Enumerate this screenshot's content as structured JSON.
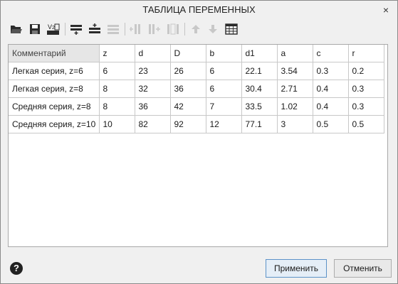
{
  "window": {
    "title": "ТАБЛИЦА ПЕРЕМЕННЫХ",
    "close_glyph": "×"
  },
  "toolbar": {
    "buttons": [
      {
        "name": "open-icon",
        "enabled": true
      },
      {
        "name": "save-icon",
        "enabled": true
      },
      {
        "name": "variables-v2-icon",
        "enabled": true
      },
      {
        "name": "insert-row-above-icon",
        "enabled": true
      },
      {
        "name": "insert-row-below-icon",
        "enabled": true
      },
      {
        "name": "delete-row-icon",
        "enabled": false
      },
      {
        "name": "insert-column-left-icon",
        "enabled": false
      },
      {
        "name": "insert-column-right-icon",
        "enabled": false
      },
      {
        "name": "delete-column-icon",
        "enabled": false
      },
      {
        "name": "move-up-icon",
        "enabled": false
      },
      {
        "name": "move-down-icon",
        "enabled": false
      },
      {
        "name": "table-settings-icon",
        "enabled": true
      }
    ]
  },
  "table": {
    "headers": [
      "Комментарий",
      "z",
      "d",
      "D",
      "b",
      "d1",
      "a",
      "c",
      "r"
    ],
    "rows": [
      [
        "Легкая серия, z=6",
        "6",
        "23",
        "26",
        "6",
        "22.1",
        "3.54",
        "0.3",
        "0.2"
      ],
      [
        "Легкая серия, z=8",
        "8",
        "32",
        "36",
        "6",
        "30.4",
        "2.71",
        "0.4",
        "0.3"
      ],
      [
        "Средняя серия, z=8",
        "8",
        "36",
        "42",
        "7",
        "33.5",
        "1.02",
        "0.4",
        "0.3"
      ],
      [
        "Средняя серия, z=10",
        "10",
        "82",
        "92",
        "12",
        "77.1",
        "3",
        "0.5",
        "0.5"
      ]
    ]
  },
  "footer": {
    "help_glyph": "?",
    "apply_label": "Применить",
    "cancel_label": "Отменить"
  },
  "colors": {
    "accent_border": "#5c92c8",
    "disabled_icon": "#c8c8c8"
  }
}
